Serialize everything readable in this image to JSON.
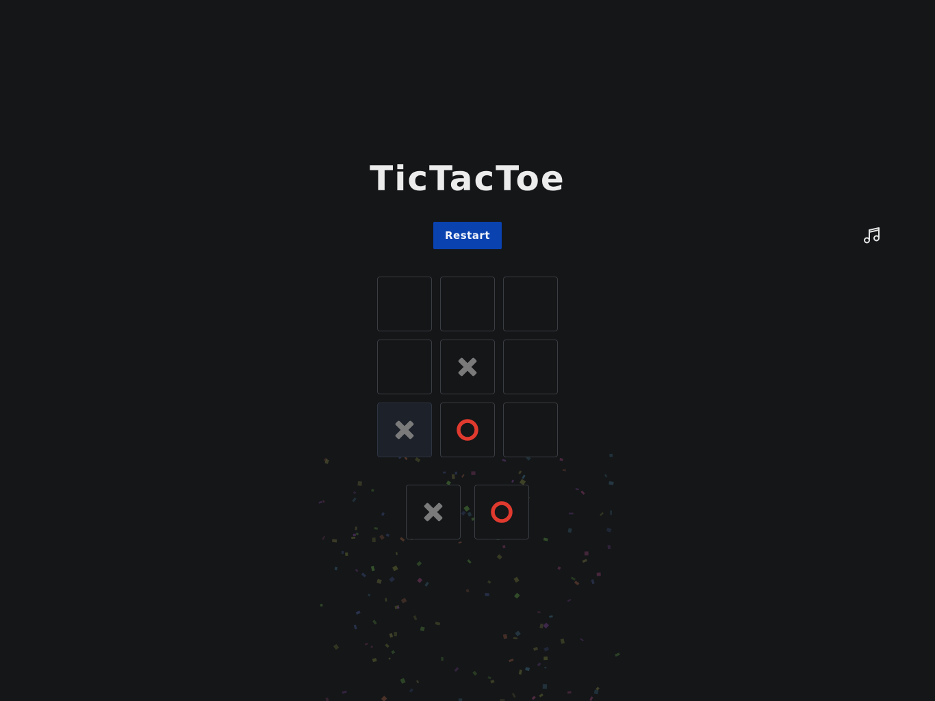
{
  "app": {
    "title": "TicTacToe"
  },
  "controls": {
    "restart_label": "Restart",
    "music_icon": "music-note-icon"
  },
  "board": {
    "cells": [
      "",
      "",
      "",
      "",
      "X",
      "",
      "X",
      "O",
      ""
    ],
    "highlighted_cell": 6
  },
  "piece_selector": {
    "pieces": [
      "X",
      "O"
    ]
  },
  "colors": {
    "background": "#141618",
    "accent": "#0a42b0",
    "x_mark": "#7a7a7a",
    "o_mark": "#e03a2f",
    "cell_border": "#3a3d42"
  }
}
